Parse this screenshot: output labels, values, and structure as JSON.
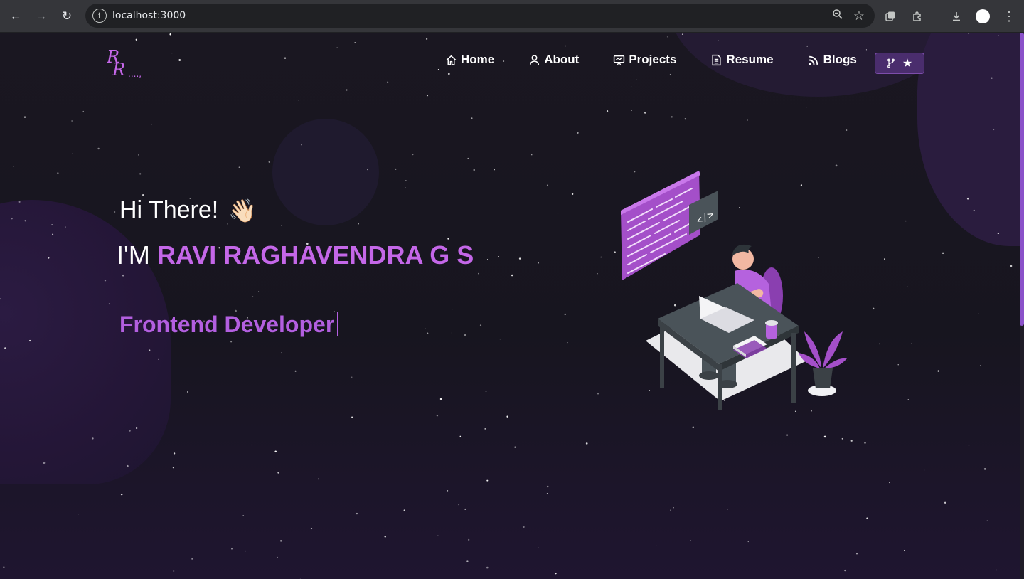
{
  "browser": {
    "url": "localhost:3000"
  },
  "nav": {
    "logo_text": "RR....,",
    "items": [
      {
        "label": "Home",
        "icon": "home-icon"
      },
      {
        "label": "About",
        "icon": "user-icon"
      },
      {
        "label": "Projects",
        "icon": "presentation-icon"
      },
      {
        "label": "Resume",
        "icon": "document-icon"
      },
      {
        "label": "Blogs",
        "icon": "rss-icon"
      }
    ],
    "fork_star_button": {
      "icons": [
        "git-fork-icon",
        "star-icon"
      ]
    }
  },
  "hero": {
    "greeting": "Hi There!",
    "wave_emoji": "👋🏻",
    "im_prefix": "I'M ",
    "name": "RAVI RAGHAVENDRA G S",
    "role": "Frontend Developer"
  },
  "colors": {
    "accent": "#c467e8",
    "role": "#b35fe0",
    "background": "#17151f",
    "button_bg": "#4a2d6d"
  }
}
